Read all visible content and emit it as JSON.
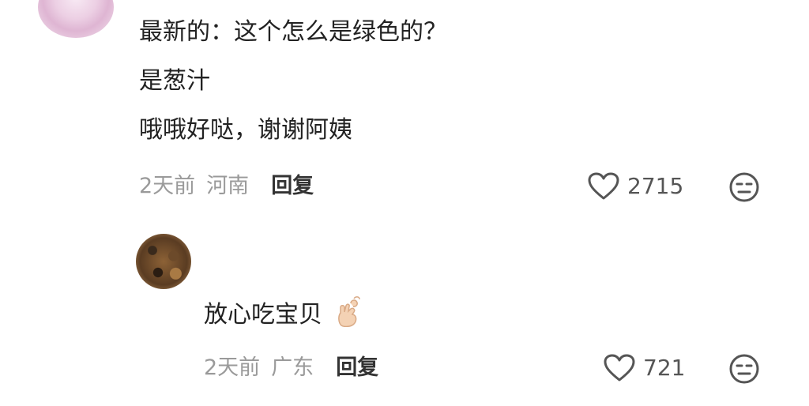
{
  "comment": {
    "lines": [
      "最新的：这个怎么是绿色的？",
      "是葱汁",
      "哦哦好哒，谢谢阿姨"
    ],
    "time": "2天前",
    "location": "河南",
    "reply_label": "回复",
    "likes": "2715"
  },
  "reply": {
    "text": "放心吃宝贝",
    "emoji": "finger-heart-emoji",
    "time": "2天前",
    "location": "广东",
    "reply_label": "回复",
    "likes": "721"
  },
  "icons": {
    "like": "heart-icon",
    "dislike": "meh-face-icon"
  },
  "colors": {
    "text": "#222222",
    "meta": "#9a9a9a",
    "icon": "#555555"
  }
}
